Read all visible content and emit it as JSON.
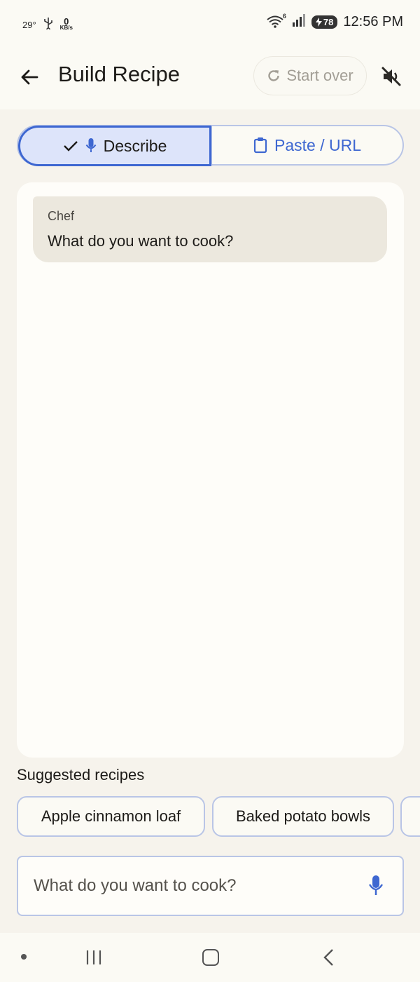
{
  "status_bar": {
    "temperature": "29°",
    "usb_icon": "usb-icon",
    "network_speed_value": "0",
    "network_speed_unit": "KB/s",
    "wifi_badge": "6",
    "battery": "78",
    "time": "12:56 PM"
  },
  "app_bar": {
    "title": "Build Recipe",
    "start_over_label": "Start over",
    "back_icon": "arrow-back-icon",
    "mute_icon": "volume-off-icon"
  },
  "mode_tabs": {
    "describe_label": "Describe",
    "paste_label": "Paste / URL",
    "selected": "Describe"
  },
  "chat": {
    "messages": [
      {
        "sender": "Chef",
        "text": "What do you want to cook?"
      }
    ]
  },
  "suggestions": {
    "label": "Suggested recipes",
    "items": [
      "Apple cinnamon loaf",
      "Baked potato bowls"
    ]
  },
  "input": {
    "placeholder": "What do you want to cook?",
    "value": ""
  },
  "colors": {
    "accent": "#3e67d1",
    "selected_tab_bg": "#dde4fa",
    "bubble_bg": "#ece8de",
    "background": "#f6f3ec"
  }
}
